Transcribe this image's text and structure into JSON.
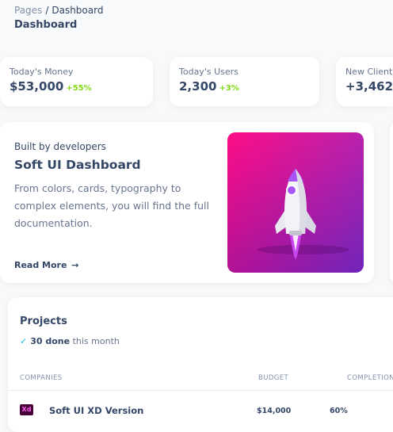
{
  "breadcrumb": {
    "root": "Pages",
    "separator": "/",
    "current": "Dashboard"
  },
  "page_title": "Dashboard",
  "stats": [
    {
      "label": "Today's Money",
      "value": "$53,000",
      "delta": "+55%"
    },
    {
      "label": "Today's Users",
      "value": "2,300",
      "delta": "+3%"
    },
    {
      "label": "New Client",
      "value": "+3,462",
      "delta": "-"
    }
  ],
  "hero": {
    "subtitle": "Built by developers",
    "title": "Soft UI Dashboard",
    "description": "From colors, cards, typography to complex elements, you will find the full documentation.",
    "read_more": "Read More",
    "arrow": "→"
  },
  "projects": {
    "title": "Projects",
    "done_count": "30 done",
    "done_suffix": "this month",
    "columns": [
      "COMPANIES",
      "BUDGET",
      "COMPLETION"
    ],
    "rows": [
      {
        "icon_label": "Xd",
        "name": "Soft UI XD Version",
        "budget": "$14,000",
        "completion": "60%"
      }
    ]
  },
  "colors": {
    "accent_green": "#82d616",
    "accent_red": "#ea0606",
    "check_blue": "#17c1e8",
    "gradient_start": "#ff0080",
    "gradient_end": "#7928ca"
  }
}
